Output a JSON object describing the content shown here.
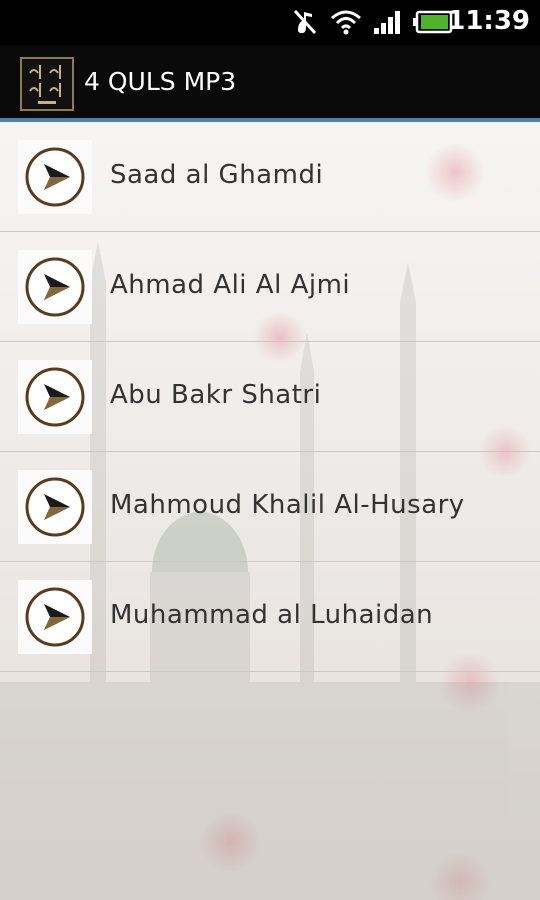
{
  "status_bar": {
    "time": "11:39",
    "icons": [
      "mute-icon",
      "wifi-icon",
      "signal-icon",
      "battery-icon"
    ]
  },
  "app_bar": {
    "title": "4 QULS MP3",
    "logo": "app-logo",
    "accent_color": "#4f81a8"
  },
  "list": {
    "items": [
      {
        "label": "Saad al Ghamdi",
        "icon": "play-icon"
      },
      {
        "label": "Ahmad Ali Al Ajmi",
        "icon": "play-icon"
      },
      {
        "label": "Abu Bakr Shatri",
        "icon": "play-icon"
      },
      {
        "label": "Mahmoud Khalil Al-Husary",
        "icon": "play-icon"
      },
      {
        "label": "Muhammad al Luhaidan",
        "icon": "play-icon"
      }
    ]
  }
}
